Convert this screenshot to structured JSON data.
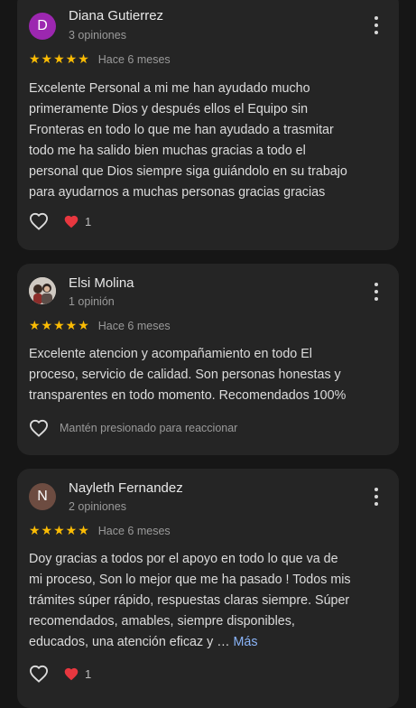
{
  "colors": {
    "star": "#fbbc04",
    "link": "#8ab4f8",
    "heart": "#e8373f"
  },
  "reviews": [
    {
      "avatar_letter": "D",
      "avatar_color": "#9c27b0",
      "name": "Diana Gutierrez",
      "count": "3 opiniones",
      "stars": "★★★★★",
      "when": "Hace 6 meses",
      "text": "Excelente Personal a mi me han ayudado mucho\nprimeramente Dios y después ellos el Equipo sin\nFronteras en todo lo que me han ayudado a trasmitar\ntodo me ha salido bien muchas gracias a todo el\npersonal que Dios siempre siga guiándolo en su trabajo\npara ayudarnos a muchas personas gracias gracias",
      "reactions": "1"
    },
    {
      "avatar_letter": "",
      "avatar_color": "#c9c3bd",
      "name": "Elsi Molina",
      "count": "1 opinión",
      "stars": "★★★★★",
      "when": "Hace 6 meses",
      "text": "Excelente atencion y acompañamiento en todo El\nproceso, servicio de calidad. Son personas honestas y\ntransparentes en todo momento. Recomendados 100%",
      "hint": "Mantén presionado para reaccionar"
    },
    {
      "avatar_letter": "N",
      "avatar_color": "#6d4c41",
      "name": "Nayleth Fernandez",
      "count": "2 opiniones",
      "stars": "★★★★★",
      "when": "Hace 6 meses",
      "text": "Doy gracias a todos por el apoyo en todo lo que va de\nmi proceso, Son lo mejor que me ha pasado ! Todos mis\ntrámites súper rápido, respuestas claras siempre. Súper\nrecomendados, amables, siempre disponibles,\neducados, una atención eficaz y … ",
      "more_link": "Más",
      "reactions": "1"
    }
  ]
}
